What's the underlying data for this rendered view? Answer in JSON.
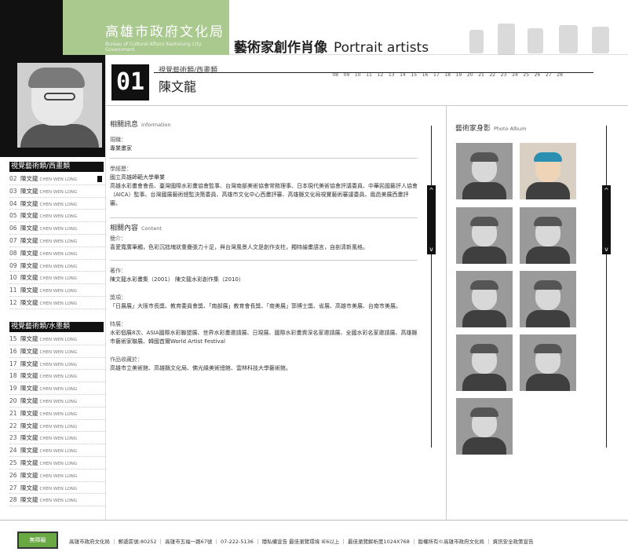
{
  "header": {
    "logo_cn": "高雄市政府文化局",
    "logo_en": "Bureau of Cultural Affairs Kaohsiung City Government",
    "title_cn": "藝術家創作肖像",
    "title_en": "Portrait artists",
    "numbers": [
      "08",
      "09",
      "10",
      "11",
      "12",
      "13",
      "14",
      "15",
      "16",
      "17",
      "18",
      "19",
      "20",
      "21",
      "22",
      "23",
      "24",
      "25",
      "26",
      "27",
      "28"
    ]
  },
  "artist": {
    "number": "01",
    "category": "視覺藝術類/西畫類",
    "name": "陳文龍"
  },
  "sidebar": {
    "category1": "視覺藝術類/西畫類",
    "category2": "視覺藝術類/水墨類",
    "list1": [
      {
        "n": "02",
        "name": "陳文龍",
        "en": "CHEN WEN LONG"
      },
      {
        "n": "03",
        "name": "陳文龍",
        "en": "CHEN WEN LONG"
      },
      {
        "n": "04",
        "name": "陳文龍",
        "en": "CHEN WEN LONG"
      },
      {
        "n": "05",
        "name": "陳文龍",
        "en": "CHEN WEN LONG"
      },
      {
        "n": "06",
        "name": "陳文龍",
        "en": "CHEN WEN LONG"
      },
      {
        "n": "07",
        "name": "陳文龍",
        "en": "CHEN WEN LONG"
      },
      {
        "n": "08",
        "name": "陳文龍",
        "en": "CHEN WEN LONG"
      },
      {
        "n": "09",
        "name": "陳文龍",
        "en": "CHEN WEN LONG"
      },
      {
        "n": "10",
        "name": "陳文龍",
        "en": "CHEN WEN LONG"
      },
      {
        "n": "11",
        "name": "陳文龍",
        "en": "CHEN WEN LONG"
      },
      {
        "n": "12",
        "name": "陳文龍",
        "en": "CHEN WEN LONG"
      }
    ],
    "list2": [
      {
        "n": "15",
        "name": "陳文龍",
        "en": "CHEN WEN LONG"
      },
      {
        "n": "16",
        "name": "陳文龍",
        "en": "CHEN WEN LONG"
      },
      {
        "n": "17",
        "name": "陳文龍",
        "en": "CHEN WEN LONG"
      },
      {
        "n": "18",
        "name": "陳文龍",
        "en": "CHEN WEN LONG"
      },
      {
        "n": "19",
        "name": "陳文龍",
        "en": "CHEN WEN LONG"
      },
      {
        "n": "20",
        "name": "陳文龍",
        "en": "CHEN WEN LONG"
      },
      {
        "n": "21",
        "name": "陳文龍",
        "en": "CHEN WEN LONG"
      },
      {
        "n": "22",
        "name": "陳文龍",
        "en": "CHEN WEN LONG"
      },
      {
        "n": "23",
        "name": "陳文龍",
        "en": "CHEN WEN LONG"
      },
      {
        "n": "24",
        "name": "陳文龍",
        "en": "CHEN WEN LONG"
      },
      {
        "n": "25",
        "name": "陳文龍",
        "en": "CHEN WEN LONG"
      },
      {
        "n": "26",
        "name": "陳文龍",
        "en": "CHEN WEN LONG"
      },
      {
        "n": "27",
        "name": "陳文龍",
        "en": "CHEN WEN LONG"
      },
      {
        "n": "28",
        "name": "陳文龍",
        "en": "CHEN WEN LONG"
      }
    ]
  },
  "info": {
    "section1_title": "相關訊息",
    "section1_en": "information",
    "position_label": "現職：",
    "position_value": "專業畫家",
    "education_label": "學經歷：",
    "education_value": "國立高雄師範大學畢業\n高雄水彩畫會會長、臺灣國際水彩畫協會監事、台灣南部美術協會常務理事、日本現代美術協會評議委員、中華民國藝評人協會（AICA）監事、台灣國展藝術總監決策委員、高雄市文化中心西畫評審、高雄縣文化局視覺藝術審議委員、鳳邑美展西畫評審。",
    "section2_title": "相關內容",
    "section2_en": "Content",
    "intro_label": "簡介：",
    "intro_value": "喜愛寬廣筆觸，色彩沉拙塊狀重疊張力十足，與台灣風景人文是創作支柱，獨特繪畫語言，自剖清新風格。",
    "works_label": "著作：",
    "works_value": "陳文龍水彩畫集（2001） 陳文龍水彩創作集（2010）",
    "awards_label": "獎項：",
    "awards_value": "「日展展」大阪市長獎、教育委員會獎、「南部展」教育會長獎、「南美展」郭博士獎、省展、高雄市美展、台南市美展。",
    "exhibit_label": "特展：",
    "exhibit_value": "水彩個展8次、ASIA國際水彩聯盟展、世界水彩畫邀請展、日現展、國際水彩畫資深名家邀請展、全國水彩名家邀請展、高雄縣市藝術家聯展、韓國首爾World Artist Festival",
    "collection_label": "作品收藏於：",
    "collection_value": "高雄市立美術館、高雄縣文化局、佛光緣美術總館、雲林科技大學藝術館。"
  },
  "album": {
    "title": "藝術家身影",
    "title_en": "Photo Album"
  },
  "scroll": {
    "up": "^",
    "down": "v"
  },
  "footer": {
    "badge": "無障礙",
    "text": "高雄市政府文化局 ｜ 郵遞區號:80252 ｜ 高雄市五福一路67號 ｜ 07-222-5136 ｜ 隱私權宣告  最佳瀏覽環境 IE6以上 ｜ 最佳瀏覽解析度1024X768 ｜ 版權所有©高雄市政府文化局 ｜ 資訊安全政策宣告"
  },
  "colors": {
    "accent_green": "#a9c98f",
    "dark": "#111111"
  }
}
